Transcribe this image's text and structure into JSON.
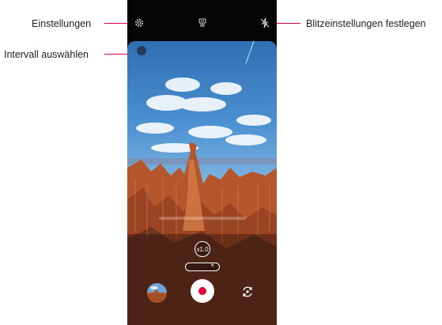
{
  "callouts": {
    "settings": "Einstellungen",
    "interval": "Intervall auswählen",
    "flash": "Blitzeinstellungen festlegen"
  },
  "camera": {
    "zoom_label": "x1.0",
    "chip_close": "×"
  },
  "icons": {
    "settings": "gear-icon",
    "interval": "interval-timer-icon",
    "flash": "flash-off-icon",
    "switch": "switch-camera-icon",
    "record": "record-button",
    "gallery": "gallery-thumbnail"
  },
  "colors": {
    "leader": "#e0004d",
    "record": "#e0003a"
  }
}
